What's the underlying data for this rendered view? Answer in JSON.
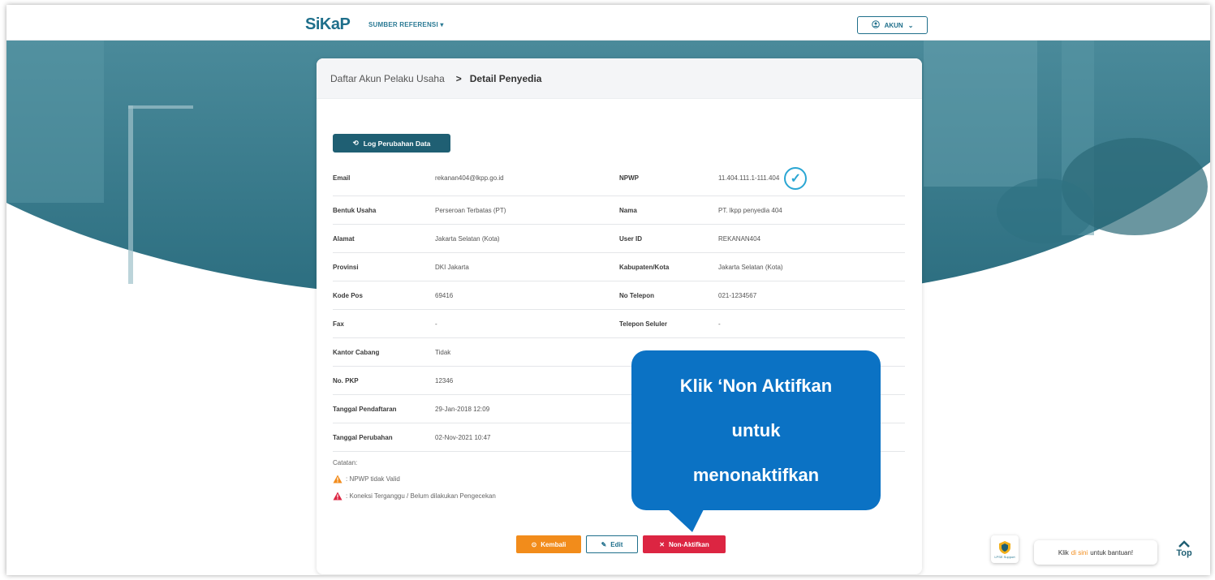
{
  "nav": {
    "logo": "SiKaP",
    "reference_menu": "SUMBER REFERENSI",
    "account_button": "AKUN"
  },
  "breadcrumb": {
    "parent": "Daftar Akun Pelaku Usaha",
    "separator": ">",
    "current": "Detail Penyedia"
  },
  "log_button": "Log Perubahan Data",
  "details": [
    {
      "label": "Email",
      "value": "rekanan404@lkpp.go.id",
      "label2": "NPWP",
      "value2": "11.404.111.1-111.404"
    },
    {
      "label": "Bentuk Usaha",
      "value": "Perseroan Terbatas (PT)",
      "label2": "Nama",
      "value2": "PT. lkpp penyedia 404"
    },
    {
      "label": "Alamat",
      "value": "Jakarta Selatan (Kota)",
      "label2": "User ID",
      "value2": "REKANAN404"
    },
    {
      "label": "Provinsi",
      "value": "DKI Jakarta",
      "label2": "Kabupaten/Kota",
      "value2": "Jakarta Selatan (Kota)"
    },
    {
      "label": "Kode Pos",
      "value": "69416",
      "label2": "No Telepon",
      "value2": "021-1234567"
    },
    {
      "label": "Fax",
      "value": "-",
      "label2": "Telepon Seluler",
      "value2": "-"
    },
    {
      "label": "Kantor Cabang",
      "value": "Tidak",
      "label2": "",
      "value2": ""
    },
    {
      "label": "No. PKP",
      "value": "12346",
      "label2": "",
      "value2": ""
    },
    {
      "label": "Tanggal Pendaftaran",
      "value": "29-Jan-2018 12:09",
      "label2": "",
      "value2": ""
    },
    {
      "label": "Tanggal Perubahan",
      "value": "02-Nov-2021 10:47",
      "label2": "",
      "value2": ""
    }
  ],
  "notes": {
    "title": "Catatan:",
    "items": [
      ": NPWP tidak Valid",
      ": Koneksi Terganggu / Belum dilakukan Pengecekan"
    ],
    "colors": [
      "#f28c1b",
      "#dc2542"
    ]
  },
  "actions": {
    "back": "Kembali",
    "edit": "Edit",
    "deactivate": "Non-Aktifkan"
  },
  "callout": {
    "lines": [
      "Klik ‘Non Aktifkan",
      "untuk",
      "menonaktifkan"
    ]
  },
  "help": {
    "icon_label": "LPSE Support",
    "prefix": "Klik",
    "link": "di sini",
    "suffix": "untuk bantuan!"
  },
  "top_button": "Top",
  "colors": {
    "primary": "#1f5f73",
    "accent_orange": "#f28c1b",
    "danger": "#dc2542",
    "callout_blue": "#0b72c4"
  }
}
